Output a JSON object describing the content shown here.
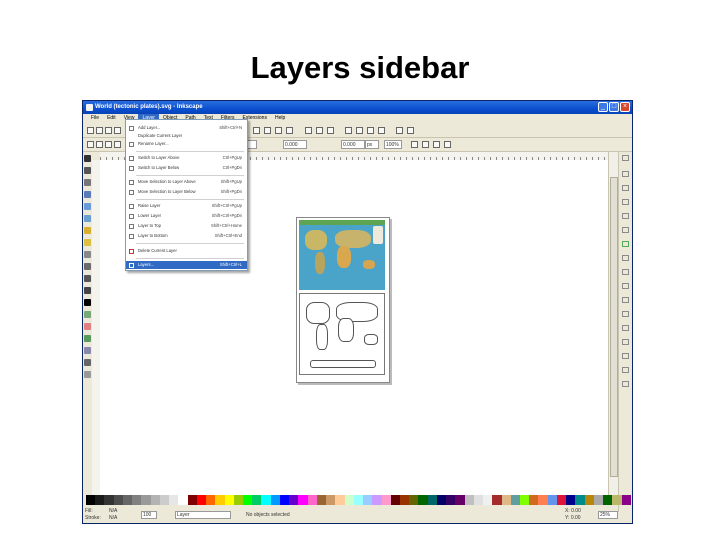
{
  "slide": {
    "title": "Layers sidebar"
  },
  "window": {
    "title": "World (tectonic plates).svg - Inkscape",
    "controls": [
      "_",
      "□",
      "×"
    ]
  },
  "menubar": {
    "items": [
      "File",
      "Edit",
      "View",
      "Layer",
      "Object",
      "Path",
      "Text",
      "Filters",
      "Extensions",
      "Help"
    ],
    "active_index": 3
  },
  "toolbar2": {
    "x_field": "0.000",
    "y_field": "0.000",
    "unit": "px",
    "zoom_field": "100%"
  },
  "layer_menu": {
    "items": [
      {
        "label": "Add Layer...",
        "shortcut": "Shift+Ctrl+N"
      },
      {
        "label": "Duplicate Current Layer",
        "shortcut": ""
      },
      {
        "label": "Rename Layer...",
        "shortcut": ""
      },
      {
        "label": "Switch to Layer Above",
        "shortcut": "Ctrl+PgUp"
      },
      {
        "label": "Switch to Layer Below",
        "shortcut": "Ctrl+PgDn"
      },
      {
        "label": "Move Selection to Layer Above",
        "shortcut": "Shift+PgUp"
      },
      {
        "label": "Move Selection to Layer Below",
        "shortcut": "Shift+PgDn"
      },
      {
        "label": "Raise Layer",
        "shortcut": "Shift+Ctrl+PgUp"
      },
      {
        "label": "Lower Layer",
        "shortcut": "Shift+Ctrl+PgDn"
      },
      {
        "label": "Layer to Top",
        "shortcut": "Shift+Ctrl+Home"
      },
      {
        "label": "Layer to Bottom",
        "shortcut": "Shift+Ctrl+End"
      },
      {
        "label": "Delete Current Layer",
        "shortcut": ""
      },
      {
        "label": "Layers...",
        "shortcut": "Shift+Ctrl+L"
      }
    ],
    "highlighted_index": 12
  },
  "statusbar": {
    "fill_label": "Fill:",
    "fill_value": "N/A",
    "stroke_label": "Stroke:",
    "stroke_value": "N/A",
    "opacity_value": "100",
    "layer_value": "Layer",
    "message": "No objects selected",
    "x_coord": "X: 0.00",
    "y_coord": "Y: 0.00",
    "zoom": "25%"
  },
  "palette_colors": [
    "#000000",
    "#1a1a1a",
    "#333333",
    "#4d4d4d",
    "#666666",
    "#808080",
    "#999999",
    "#b3b3b3",
    "#cccccc",
    "#e6e6e6",
    "#ffffff",
    "#800000",
    "#ff0000",
    "#ff6600",
    "#ffcc00",
    "#ffff00",
    "#99cc00",
    "#00ff00",
    "#00cc66",
    "#00ffff",
    "#0099ff",
    "#0000ff",
    "#6600cc",
    "#ff00ff",
    "#ff66cc",
    "#996633",
    "#cc9966",
    "#ffcc99",
    "#ccffcc",
    "#99ffff",
    "#99ccff",
    "#cc99ff",
    "#ff99cc",
    "#660000",
    "#993300",
    "#666600",
    "#006600",
    "#006666",
    "#000066",
    "#330066",
    "#660066",
    "#c0c0c0",
    "#e0e0e0",
    "#f0f0f0",
    "#a52a2a",
    "#deb887",
    "#5f9ea0",
    "#7fff00",
    "#d2691e",
    "#ff7f50",
    "#6495ed",
    "#dc143c",
    "#00008b",
    "#008b8b",
    "#b8860b",
    "#a9a9a9",
    "#006400",
    "#bdb76b",
    "#8b008b"
  ]
}
